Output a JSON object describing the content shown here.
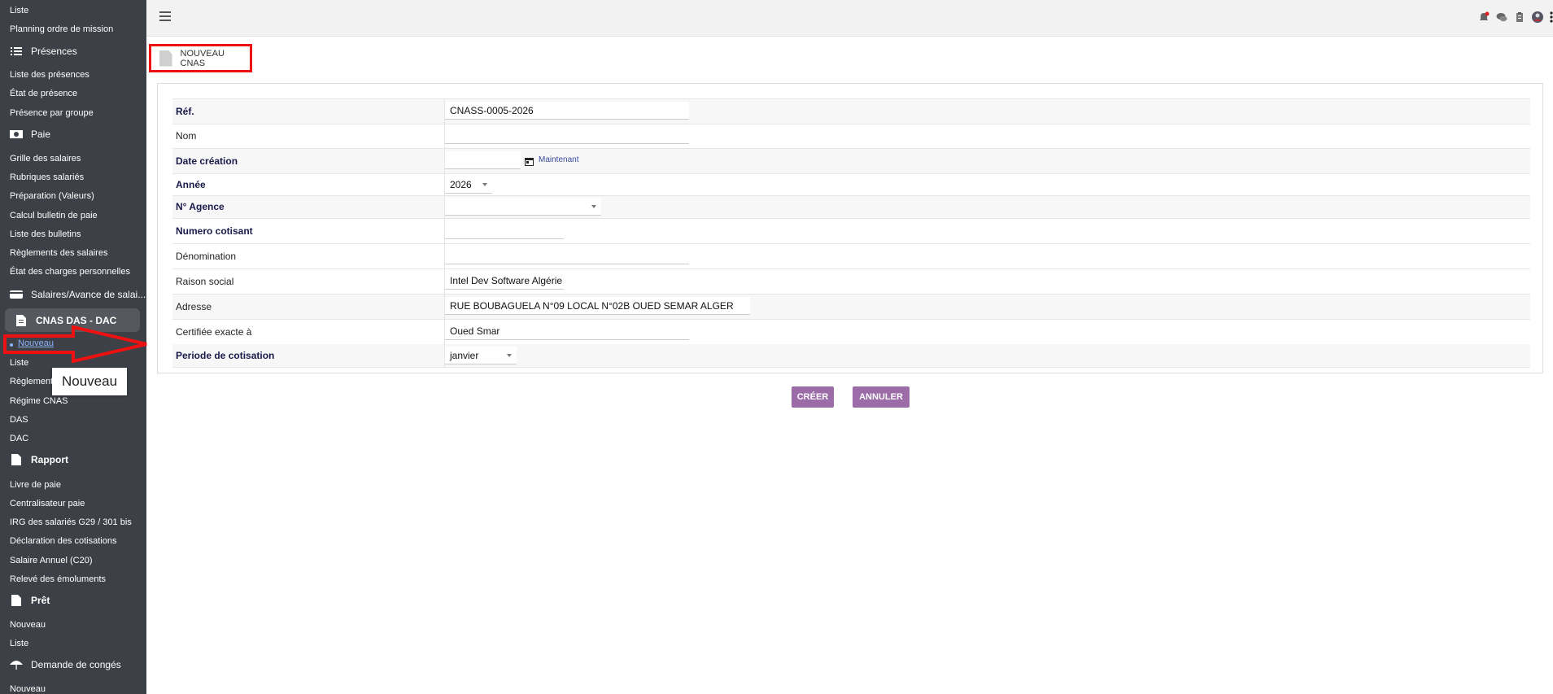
{
  "sidebar": {
    "top_links": [
      "Liste",
      "Planning ordre de mission"
    ],
    "presences": {
      "label": "Présences",
      "items": [
        "Liste des présences",
        "État de présence",
        "Présence par groupe"
      ]
    },
    "paie": {
      "label": "Paie",
      "items": [
        "Grille des salaires",
        "Rubriques salariés",
        "Préparation (Valeurs)",
        "Calcul bulletin de paie",
        "Liste des bulletins",
        "Règlements des salaires",
        "État des charges personnelles"
      ]
    },
    "salaires_avance": "Salaires/Avance de salai...",
    "cnas": {
      "label": "CNAS DAS - DAC",
      "nouveau": "Nouveau",
      "items": [
        "Liste",
        "Règlement",
        "Régime CNAS",
        "DAS",
        "DAC"
      ]
    },
    "rapport": {
      "label": "Rapport",
      "items": [
        "Livre de paie",
        "Centralisateur paie",
        "IRG des salariés G29 / 301 bis",
        "Déclaration des cotisations",
        "Salaire Annuel (C20)",
        "Relevé des émoluments"
      ]
    },
    "pret": {
      "label": "Prêt",
      "items": [
        "Nouveau",
        "Liste"
      ]
    },
    "conges": {
      "label": "Demande de congés",
      "items": [
        "Nouveau"
      ]
    }
  },
  "tooltip": "Nouveau",
  "page": {
    "title": "NOUVEAU CNAS"
  },
  "form": {
    "ref": {
      "label": "Réf.",
      "value": "CNASS-0005-2026"
    },
    "nom": {
      "label": "Nom",
      "value": ""
    },
    "date_creation": {
      "label": "Date création",
      "value": "",
      "now_label": "Maintenant"
    },
    "annee": {
      "label": "Année",
      "value": "2026"
    },
    "agence": {
      "label": "N° Agence",
      "value": ""
    },
    "numero_cotisant": {
      "label": "Numero cotisant",
      "value": ""
    },
    "denomination": {
      "label": "Dénomination",
      "value": ""
    },
    "raison_social": {
      "label": "Raison social",
      "value": "Intel Dev Software Algérie"
    },
    "adresse": {
      "label": "Adresse",
      "value": "RUE BOUBAGUELA N°09 LOCAL N°02B OUED SEMAR ALGER"
    },
    "certifiee": {
      "label": "Certifiée exacte à",
      "value": "Oued Smar"
    },
    "periode": {
      "label": "Periode de cotisation",
      "value": "janvier"
    }
  },
  "buttons": {
    "create": "CRÉER",
    "cancel": "ANNULER"
  },
  "colors": {
    "sidebar_bg": "#3d4047",
    "button_bg": "#9b6ca8",
    "highlight_red": "#e11111"
  }
}
